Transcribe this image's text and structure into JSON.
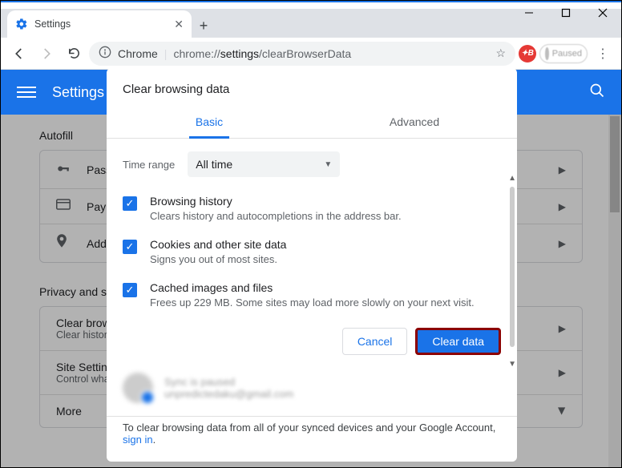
{
  "window": {
    "tab_title": "Settings"
  },
  "omnibox": {
    "prefix": "Chrome",
    "scheme": "chrome://",
    "path_main": "settings",
    "path_rest": "/clearBrowserData"
  },
  "profile_chip": "Paused",
  "header": {
    "title": "Settings"
  },
  "page": {
    "section1": "Autofill",
    "rows1": {
      "passwords": "Pass",
      "payment": "Payn",
      "addresses": "Add"
    },
    "section2": "Privacy and s",
    "rows2": {
      "clear_t": "Clear brows",
      "clear_s": "Clear histor",
      "site_t": "Site Setting",
      "site_s": "Control wha",
      "more": "More"
    }
  },
  "dialog": {
    "title": "Clear browsing data",
    "tabs": {
      "basic": "Basic",
      "advanced": "Advanced"
    },
    "time_label": "Time range",
    "time_value": "All time",
    "items": [
      {
        "title": "Browsing history",
        "sub": "Clears history and autocompletions in the address bar."
      },
      {
        "title": "Cookies and other site data",
        "sub": "Signs you out of most sites."
      },
      {
        "title": "Cached images and files",
        "sub": "Frees up 229 MB. Some sites may load more slowly on your next visit."
      }
    ],
    "cancel": "Cancel",
    "clear": "Clear data",
    "sync_title": "Sync is paused",
    "sync_email": "unpredictedaku@gmail.com",
    "footer_text": "To clear browsing data from all of your synced devices and your Google Account, ",
    "footer_link": "sign in"
  }
}
